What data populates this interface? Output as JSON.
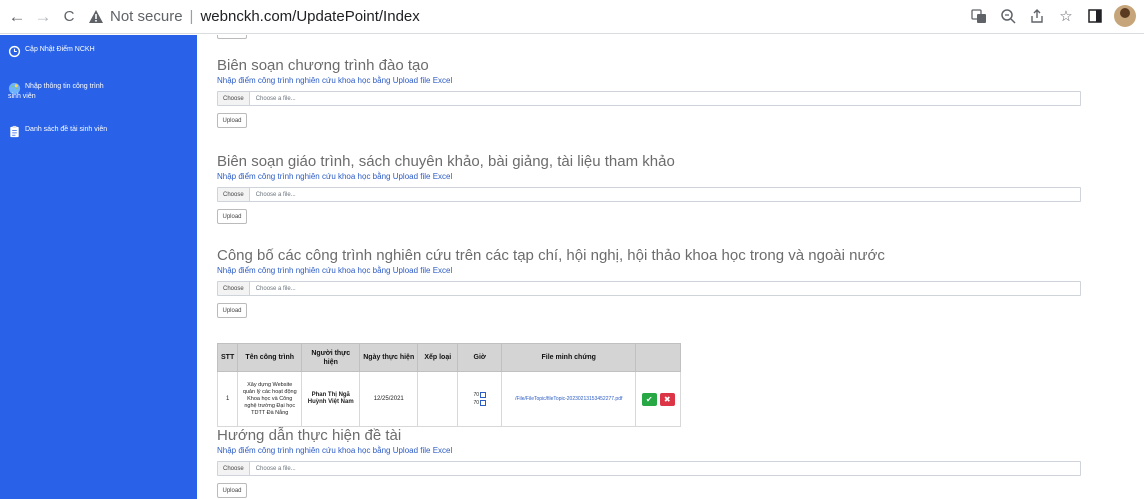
{
  "browser": {
    "back": "←",
    "forward": "→",
    "reload": "C",
    "not_secure": "Not secure",
    "url": "webnckh.com/UpdatePoint/Index"
  },
  "sidebar": {
    "items": [
      {
        "label": "Cập Nhật Điểm NCKH",
        "icon": "clock-icon"
      },
      {
        "label": "Nhập thông tin công trình",
        "label2": "sinh viên",
        "icon": "globe-icon"
      },
      {
        "label": "Danh sách đề tài sinh viên",
        "icon": "clipboard-icon"
      }
    ]
  },
  "common": {
    "choose": "Choose",
    "file_placeholder": "Choose a file...",
    "upload": "Upload",
    "subtitle": "Nhập điểm công trình nghiên cứu khoa học bằng Upload file Excel"
  },
  "sections": [
    {
      "title": "Biên soạn chương trình đào tạo"
    },
    {
      "title": "Biên soạn giáo trình, sách chuyên khảo, bài giảng, tài liệu tham khảo"
    },
    {
      "title": "Công bố các công trình nghiên cứu trên các tạp chí, hội nghị, hội thảo khoa học trong và ngoài nước"
    },
    {
      "title": "Hướng dẫn thực hiện đề tài"
    }
  ],
  "table": {
    "headers": [
      "STT",
      "Tên công trình",
      "Người thực hiện",
      "Ngày thực hiện",
      "Xếp loại",
      "Giờ",
      "File minh chứng",
      ""
    ],
    "rows": [
      {
        "stt": "1",
        "name": "Xây dựng Website quản lý các hoạt động Khoa học và Công nghệ trường Đại học TDTT Đà Nẵng",
        "person": "Phan Thị Ngã Huỳnh Việt Nam",
        "date": "12/25/2021",
        "grade": "",
        "hours1": "70",
        "hours2": "70",
        "file": "/File/FileTopic/fileTopic-20230213153452277.pdf"
      }
    ]
  },
  "colors": {
    "sidebar": "#2962e8",
    "link": "#2c5cc5",
    "ok": "#28a745",
    "delete": "#dc3545"
  }
}
